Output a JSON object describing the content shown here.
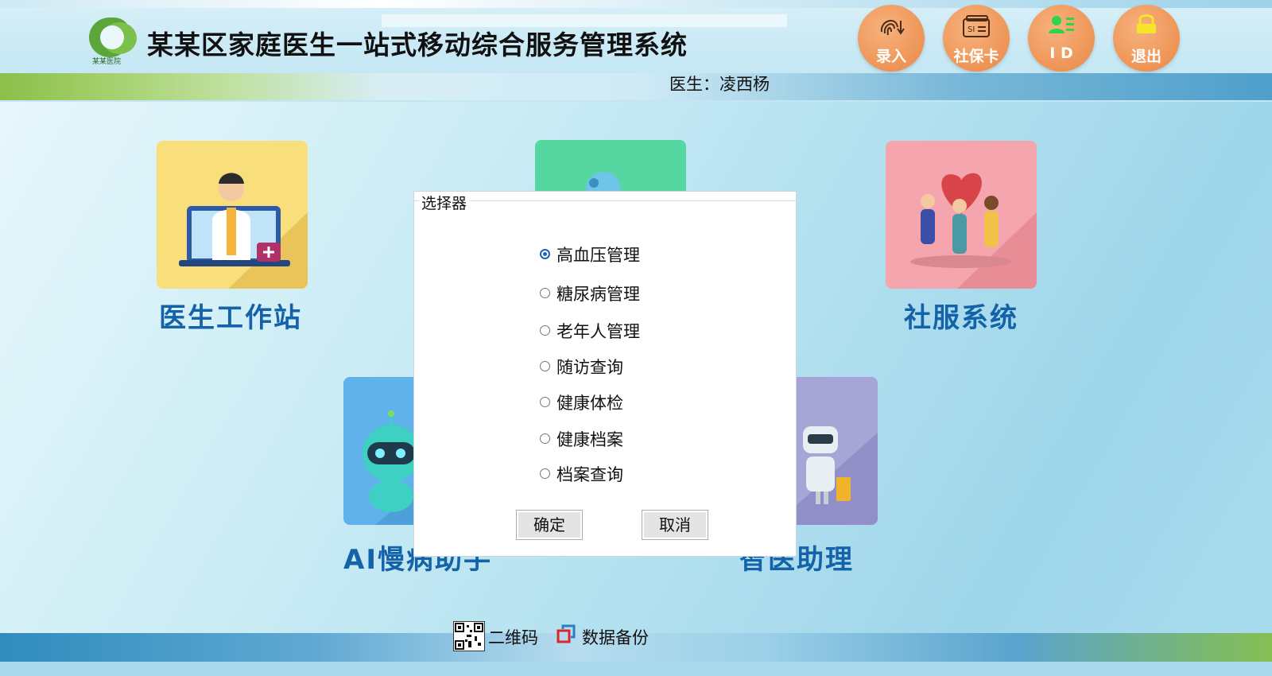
{
  "header": {
    "app_title": "某某区家庭医生一站式移动综合服务管理系统",
    "logo_text": "某某医院",
    "doctor_label": "医生：凌西杨",
    "tools": [
      {
        "label": "录入",
        "icon": "fingerprint-icon"
      },
      {
        "label": "社保卡",
        "icon": "social-security-card-icon"
      },
      {
        "label": "I D",
        "icon": "id-card-icon"
      },
      {
        "label": "退出",
        "icon": "lock-icon"
      }
    ]
  },
  "tiles": [
    {
      "label": "医生工作站",
      "color": "#f8df7c"
    },
    {
      "label": "",
      "color": "#56d6a0"
    },
    {
      "label": "社服系统",
      "color": "#f4a5ad"
    },
    {
      "label": "AI慢病助手",
      "color": "#5fb2ea"
    },
    {
      "label": "智医助理",
      "color": "#a7a4d6"
    }
  ],
  "modal": {
    "title": "选择器",
    "options": [
      {
        "label": "高血压管理",
        "selected": true
      },
      {
        "label": "糖尿病管理",
        "selected": false
      },
      {
        "label": "老年人管理",
        "selected": false
      },
      {
        "label": "随访查询",
        "selected": false
      },
      {
        "label": "健康体检",
        "selected": false
      },
      {
        "label": "健康档案",
        "selected": false
      },
      {
        "label": "档案查询",
        "selected": false
      }
    ],
    "ok_label": "确定",
    "cancel_label": "取消"
  },
  "footer": {
    "qr_label": "二维码",
    "backup_label": "数据备份"
  },
  "colors": {
    "accent_orange": "#ee9456",
    "tile_label_blue": "#1462a8",
    "radio_blue": "#1e64b4"
  }
}
